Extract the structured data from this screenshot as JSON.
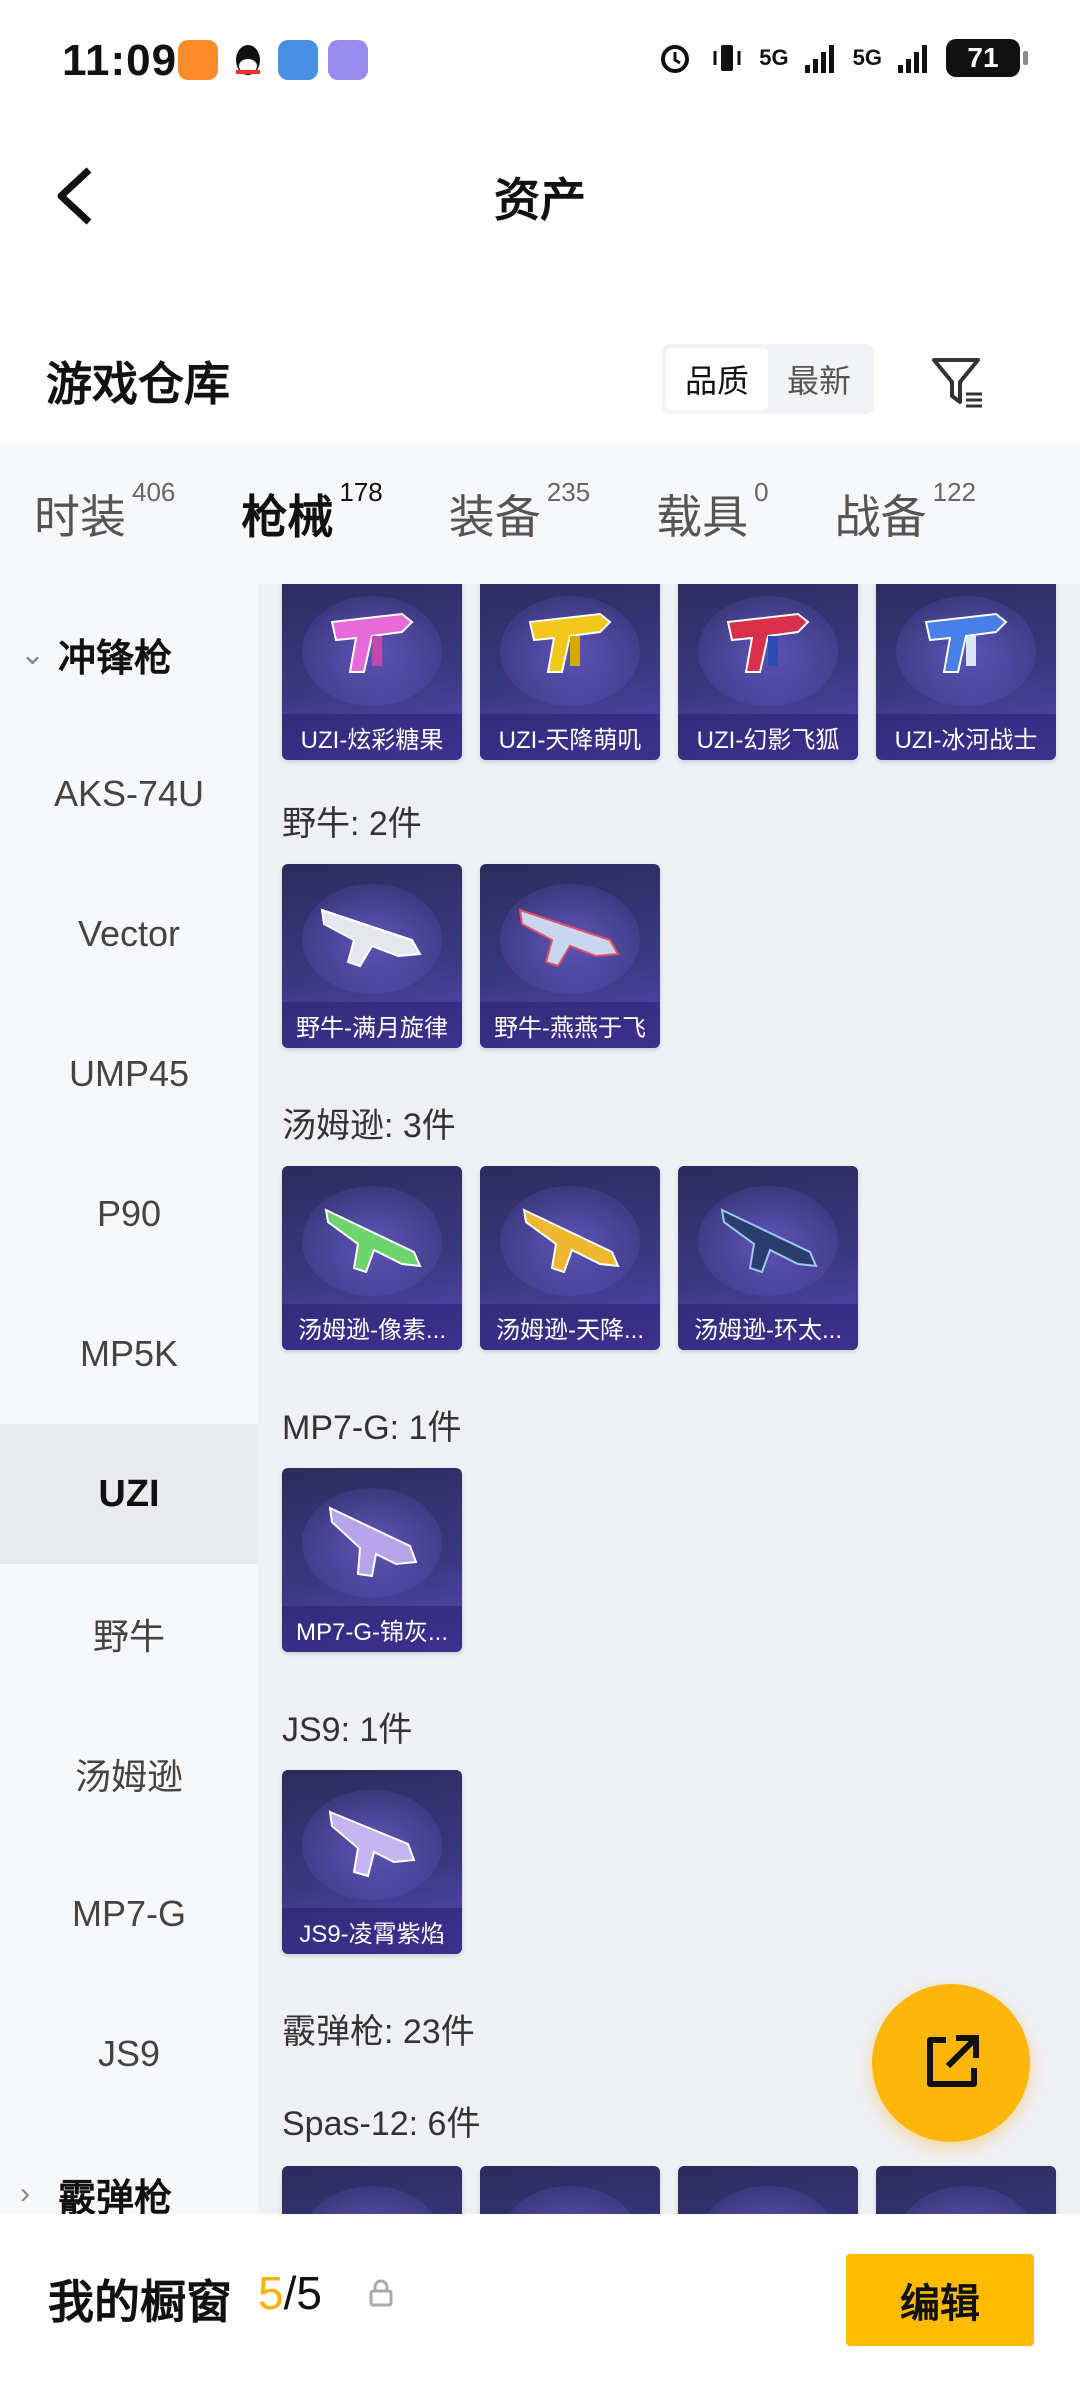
{
  "status_bar": {
    "time": "11:09",
    "signal_1": "5G",
    "signal_2": "5G",
    "battery": "71"
  },
  "header": {
    "title": "资产"
  },
  "section": {
    "title": "游戏仓库",
    "sort_options": [
      "品质",
      "最新"
    ],
    "active_sort": "品质"
  },
  "tabs": [
    {
      "label": "时装",
      "count": "406"
    },
    {
      "label": "枪械",
      "count": "178"
    },
    {
      "label": "装备",
      "count": "235"
    },
    {
      "label": "载具",
      "count": "0"
    },
    {
      "label": "战备",
      "count": "122"
    }
  ],
  "sidebar": {
    "group_open": "冲锋枪",
    "items": [
      "AKS-74U",
      "Vector",
      "UMP45",
      "P90",
      "MP5K",
      "UZI",
      "野牛",
      "汤姆逊",
      "MP7-G",
      "JS9"
    ],
    "active": "UZI",
    "group_closed": "霰弹枪"
  },
  "content": {
    "uzi_items": [
      "UZI-炫彩糖果",
      "UZI-天降萌叽",
      "UZI-幻影飞狐",
      "UZI-冰河战士"
    ],
    "bison_title": "野牛: 2件",
    "bison_items": [
      "野牛-满月旋律",
      "野牛-燕燕于飞"
    ],
    "thompson_title": "汤姆逊: 3件",
    "thompson_items": [
      "汤姆逊-像素...",
      "汤姆逊-天降...",
      "汤姆逊-环太..."
    ],
    "mp7_title": "MP7-G: 1件",
    "mp7_items": [
      "MP7-G-锦灰..."
    ],
    "js9_title": "JS9: 1件",
    "js9_items": [
      "JS9-凌霄紫焰"
    ],
    "shotgun_title": "霰弹枪: 23件",
    "spas_title": "Spas-12: 6件"
  },
  "bottom": {
    "window_label": "我的橱窗",
    "window_current": "5",
    "window_total": "/5",
    "edit_label": "编辑"
  },
  "colors": {
    "accent": "#ffb800",
    "card_bg": "#3a3880"
  }
}
